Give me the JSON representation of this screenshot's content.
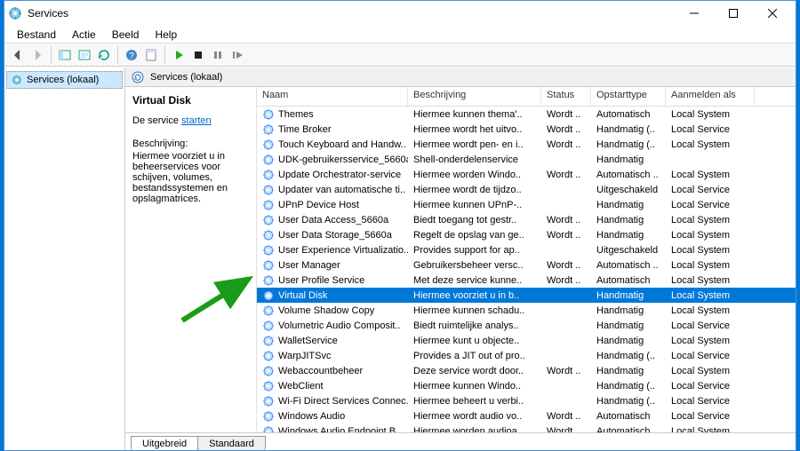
{
  "window": {
    "title": "Services"
  },
  "menubar": [
    "Bestand",
    "Actie",
    "Beeld",
    "Help"
  ],
  "nav": {
    "label": "Services (lokaal)"
  },
  "header": {
    "label": "Services (lokaal)"
  },
  "detail": {
    "title": "Virtual Disk",
    "link_prefix": "De service ",
    "link_text": "starten",
    "desc_label": "Beschrijving:",
    "description": "Hiermee voorziet u in beheerservices voor schijven, volumes, bestandssystemen en opslagmatrices."
  },
  "columns": {
    "name": "Naam",
    "description": "Beschrijving",
    "status": "Status",
    "startup": "Opstarttype",
    "logon": "Aanmelden als"
  },
  "tabs": [
    "Uitgebreid",
    "Standaard"
  ],
  "services": [
    {
      "name": "Themes",
      "desc": "Hiermee kunnen thema'..",
      "status": "Wordt ..",
      "startup": "Automatisch",
      "logon": "Local System"
    },
    {
      "name": "Time Broker",
      "desc": "Hiermee wordt het uitvo..",
      "status": "Wordt ..",
      "startup": "Handmatig (..",
      "logon": "Local Service"
    },
    {
      "name": "Touch Keyboard and Handw..",
      "desc": "Hiermee wordt pen- en i..",
      "status": "Wordt ..",
      "startup": "Handmatig (..",
      "logon": "Local System"
    },
    {
      "name": "UDK-gebruikersservice_5660a",
      "desc": "Shell-onderdelenservice",
      "status": "",
      "startup": "Handmatig",
      "logon": ""
    },
    {
      "name": "Update Orchestrator-service",
      "desc": "Hiermee worden Windo..",
      "status": "Wordt ..",
      "startup": "Automatisch ..",
      "logon": "Local System"
    },
    {
      "name": "Updater van automatische ti..",
      "desc": "Hiermee wordt de tijdzo..",
      "status": "",
      "startup": "Uitgeschakeld",
      "logon": "Local Service"
    },
    {
      "name": "UPnP Device Host",
      "desc": "Hiermee kunnen UPnP-..",
      "status": "",
      "startup": "Handmatig",
      "logon": "Local Service"
    },
    {
      "name": "User Data Access_5660a",
      "desc": "Biedt toegang tot gestr..",
      "status": "Wordt ..",
      "startup": "Handmatig",
      "logon": "Local System"
    },
    {
      "name": "User Data Storage_5660a",
      "desc": "Regelt de opslag van ge..",
      "status": "Wordt ..",
      "startup": "Handmatig",
      "logon": "Local System"
    },
    {
      "name": "User Experience Virtualizatio..",
      "desc": "Provides support for ap..",
      "status": "",
      "startup": "Uitgeschakeld",
      "logon": "Local System"
    },
    {
      "name": "User Manager",
      "desc": "Gebruikersbeheer versc..",
      "status": "Wordt ..",
      "startup": "Automatisch ..",
      "logon": "Local System"
    },
    {
      "name": "User Profile Service",
      "desc": "Met deze service kunne..",
      "status": "Wordt ..",
      "startup": "Automatisch",
      "logon": "Local System"
    },
    {
      "name": "Virtual Disk",
      "desc": "Hiermee voorziet u in b..",
      "status": "",
      "startup": "Handmatig",
      "logon": "Local System",
      "selected": true
    },
    {
      "name": "Volume Shadow Copy",
      "desc": "Hiermee kunnen schadu..",
      "status": "",
      "startup": "Handmatig",
      "logon": "Local System"
    },
    {
      "name": "Volumetric Audio Composit..",
      "desc": "Biedt ruimtelijke analys..",
      "status": "",
      "startup": "Handmatig",
      "logon": "Local Service"
    },
    {
      "name": "WalletService",
      "desc": "Hiermee kunt u objecte..",
      "status": "",
      "startup": "Handmatig",
      "logon": "Local System"
    },
    {
      "name": "WarpJITSvc",
      "desc": "Provides a JIT out of pro..",
      "status": "",
      "startup": "Handmatig (..",
      "logon": "Local Service"
    },
    {
      "name": "Webaccountbeheer",
      "desc": "Deze service wordt door..",
      "status": "Wordt ..",
      "startup": "Handmatig",
      "logon": "Local System"
    },
    {
      "name": "WebClient",
      "desc": "Hiermee kunnen Windo..",
      "status": "",
      "startup": "Handmatig (..",
      "logon": "Local Service"
    },
    {
      "name": "Wi-Fi Direct Services Connec..",
      "desc": "Hiermee beheert u verbi..",
      "status": "",
      "startup": "Handmatig (..",
      "logon": "Local Service"
    },
    {
      "name": "Windows Audio",
      "desc": "Hiermee wordt audio vo..",
      "status": "Wordt ..",
      "startup": "Automatisch",
      "logon": "Local Service"
    },
    {
      "name": "Windows Audio Endpoint B..",
      "desc": "Hiermee worden audioa..",
      "status": "Wordt ..",
      "startup": "Automatisch",
      "logon": "Local System"
    }
  ]
}
